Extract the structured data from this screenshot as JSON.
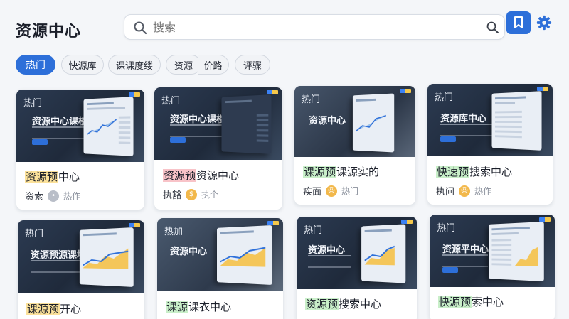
{
  "header": {
    "title": "资源中心",
    "search_placeholder": "搜索"
  },
  "tabs": [
    {
      "label": "热门",
      "active": true
    },
    {
      "label": "快源库",
      "active": false
    },
    {
      "label": "课课度缕",
      "active": false
    },
    {
      "label": "资源",
      "active": false
    },
    {
      "label": "价路",
      "active": false
    },
    {
      "label": "评骤",
      "active": false
    }
  ],
  "colors": {
    "accent": "#2d6fd9",
    "highlight_yellow": "#fbe19a",
    "highlight_pink": "#f8c3c8",
    "highlight_green": "#c9efc9"
  },
  "cards": [
    {
      "tag": "热门",
      "thumb_text": "资源中心课楼视频",
      "title_hl": "资源预",
      "title_rest": "中心",
      "hl_color": "#fbe19a",
      "meta": "资索",
      "meta_sub": "热作",
      "dot_color": "#b9bec8"
    },
    {
      "tag": "热门",
      "thumb_text": "资源中心课楼视频",
      "title_hl": "资源预",
      "title_rest": "资源中心",
      "hl_color": "#f8c3c8",
      "meta": "执豁",
      "meta_sub": "执个",
      "dot_color": "#f2b84b"
    },
    {
      "tag": "热门",
      "thumb_text": "资源中心",
      "title_hl": "课源预",
      "title_rest": "课源实的",
      "hl_color": "#c9efc9",
      "meta": "疾面",
      "meta_sub": "热门",
      "dot_color": "#f2b84b"
    },
    {
      "tag": "热门",
      "thumb_text": "资源库中心",
      "title_hl": "快速预",
      "title_rest": "搜索中心",
      "hl_color": "#c9efc9",
      "meta": "执问",
      "meta_sub": "热作",
      "dot_color": "#f2b84b"
    },
    {
      "tag": "热门",
      "thumb_text": "资源预源课坊",
      "title_hl": "课源预",
      "title_rest": "开心",
      "hl_color": "#fbe19a",
      "meta": "",
      "meta_sub": "",
      "dot_color": "#f2b84b"
    },
    {
      "tag": "热加",
      "thumb_text": "资源中心",
      "title_hl": "课源",
      "title_rest": "课衣中心",
      "hl_color": "#c9efc9",
      "meta": "",
      "meta_sub": "",
      "dot_color": "#f2b84b"
    },
    {
      "tag": "热门",
      "thumb_text": "资源中心",
      "title_hl": "资源预",
      "title_rest": "搜索中心",
      "hl_color": "#c9efc9",
      "meta": "",
      "meta_sub": "",
      "dot_color": "#f2b84b"
    },
    {
      "tag": "热门",
      "thumb_text": "资源平中心",
      "title_hl": "快源预",
      "title_rest": "索中心",
      "hl_color": "#c9efc9",
      "meta": "",
      "meta_sub": "",
      "dot_color": "#f2b84b"
    }
  ]
}
